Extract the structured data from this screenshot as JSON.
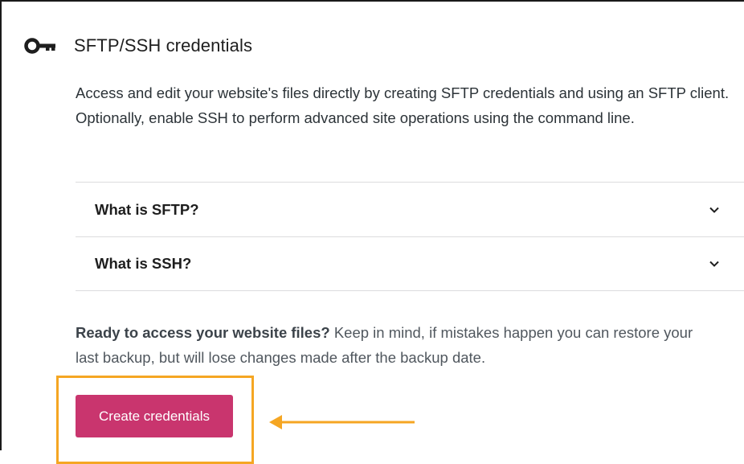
{
  "header": {
    "title": "SFTP/SSH credentials",
    "icon": "key-icon"
  },
  "description": "Access and edit your website's files directly by creating SFTP credentials and using an SFTP client. Optionally, enable SSH to perform advanced site operations using the command line.",
  "accordion": {
    "items": [
      {
        "label": "What is SFTP?",
        "icon": "chevron-down-icon"
      },
      {
        "label": "What is SSH?",
        "icon": "chevron-down-icon"
      }
    ]
  },
  "ready": {
    "bold": "Ready to access your website files?",
    "rest": " Keep in mind, if mistakes happen you can restore your last backup, but will lose changes made after the backup date."
  },
  "create_button": {
    "label": "Create credentials"
  },
  "colors": {
    "button": "#c9356e",
    "highlight": "#f5a623",
    "divider": "#dcdcde"
  }
}
